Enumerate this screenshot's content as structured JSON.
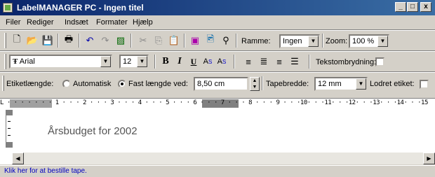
{
  "window": {
    "title": "LabelMANAGER PC - Ingen titel",
    "controls": {
      "minimize": "_",
      "maximize": "□",
      "close": "x"
    }
  },
  "menu": {
    "items": [
      "Filer",
      "Rediger",
      "Indsæt",
      "Formater",
      "Hjælp"
    ]
  },
  "toolbar1": {
    "ramme_label": "Ramme:",
    "ramme_value": "Ingen",
    "zoom_label": "Zoom:",
    "zoom_value": "100 %"
  },
  "toolbar2": {
    "font_value": "Arial",
    "size_value": "12",
    "bold": "B",
    "italic": "I",
    "underline": "U",
    "superscript": "A",
    "superscript_mark": "S",
    "subscript": "A",
    "subscript_mark": "S",
    "wrap_label": "Tekstombrydning:",
    "wrap_checked": false
  },
  "toolbar3": {
    "length_label": "Etiketlængde:",
    "auto_label": "Automatisk",
    "fixed_label": "Fast længde ved:",
    "selected": "fixed",
    "length_value": "8,50 cm",
    "tape_label": "Tapebredde:",
    "tape_value": "12 mm",
    "vertical_label": "Lodret etiket:",
    "vertical_checked": false
  },
  "ruler": {
    "text": "L · · · · · · · 1 · · · 2 · · · 3 · · · 4 · · · 5 · · · 6 · · · 7 · · · 8 · · · 9 · · ·10· · ·11· · ·12· · ·13· · ·14· · ·15"
  },
  "document": {
    "text": "Årsbudget for 2002"
  },
  "status": {
    "text": "Klik her for at bestille tape."
  }
}
